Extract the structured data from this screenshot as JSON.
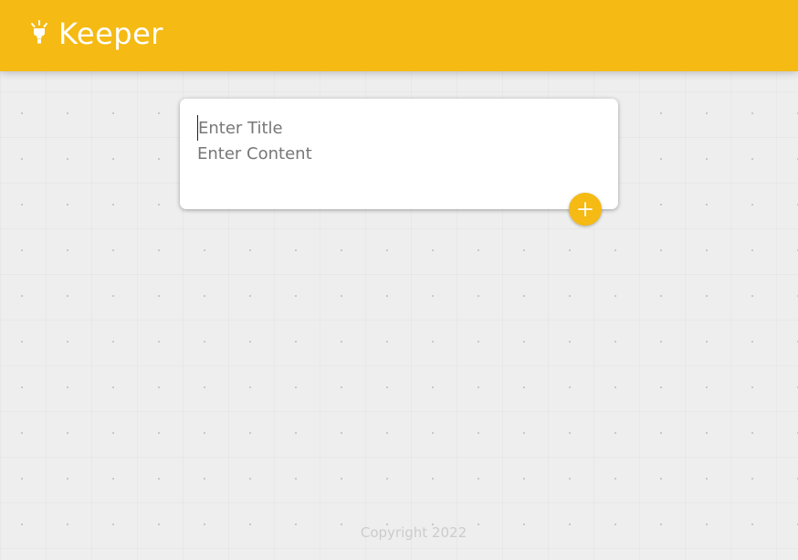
{
  "header": {
    "logo_icon": "lightbulb-icon",
    "title": "Keeper",
    "background_color": "#f5ba13"
  },
  "create_note": {
    "title_placeholder": "Enter Title",
    "content_placeholder": "Enter Content",
    "title_value": "",
    "content_value": "",
    "add_button_icon": "plus-icon",
    "accent_color": "#f5ba13"
  },
  "footer": {
    "copyright": "Copyright 2022"
  }
}
